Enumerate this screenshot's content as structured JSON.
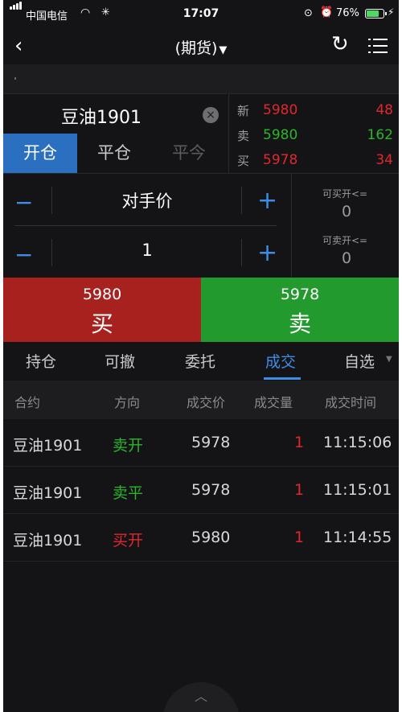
{
  "status": {
    "carrier": "中国电信",
    "time": "17:07",
    "battery_pct": "76%",
    "wifi_icon": "wifi-icon",
    "battery_level": 0.76,
    "accent_battery": "#4cd964"
  },
  "nav": {
    "title": "(期货)",
    "title_caret": "▼",
    "back_icon": "‹"
  },
  "contract": {
    "name": "豆油1901",
    "clear_icon": "×"
  },
  "order_tabs": [
    {
      "label": "开仓",
      "active": true
    },
    {
      "label": "平仓",
      "active": false
    },
    {
      "label": "平今",
      "active": false
    }
  ],
  "quote": {
    "rows": [
      {
        "label": "新",
        "price": "5980",
        "volume": "48",
        "price_color": "#e0282c",
        "volume_color": "#e0282c"
      },
      {
        "label": "卖",
        "price": "5980",
        "volume": "162",
        "price_color": "#2bb52b",
        "volume_color": "#2bb52b"
      },
      {
        "label": "买",
        "price": "5978",
        "volume": "34",
        "price_color": "#e0282c",
        "volume_color": "#e0282c"
      }
    ]
  },
  "order_form": {
    "price_type": "对手价",
    "quantity": "1",
    "minus": "−",
    "plus": "+",
    "can_buy_label": "可买开<=",
    "can_buy_value": "0",
    "can_sell_label": "可卖开<=",
    "can_sell_value": "0"
  },
  "actions": {
    "buy_price": "5980",
    "buy_label": "买",
    "sell_price": "5978",
    "sell_label": "卖",
    "buy_color": "#a7211e",
    "sell_color": "#239a2d"
  },
  "bottom_tabs": [
    {
      "label": "持仓",
      "active": false
    },
    {
      "label": "可撤",
      "active": false
    },
    {
      "label": "委托",
      "active": false
    },
    {
      "label": "成交",
      "active": true
    },
    {
      "label": "自选",
      "active": false
    }
  ],
  "trades": {
    "headers": [
      "合约",
      "方向",
      "成交价",
      "成交量",
      "成交时间"
    ],
    "rows": [
      {
        "contract": "豆油1901",
        "direction": "卖开",
        "direction_color": "#2bb52b",
        "price": "5978",
        "qty": "1",
        "time": "11:15:06"
      },
      {
        "contract": "豆油1901",
        "direction": "卖平",
        "direction_color": "#2bb52b",
        "price": "5978",
        "qty": "1",
        "time": "11:15:01"
      },
      {
        "contract": "豆油1901",
        "direction": "买开",
        "direction_color": "#e0282c",
        "price": "5980",
        "qty": "1",
        "time": "11:14:55"
      }
    ]
  }
}
